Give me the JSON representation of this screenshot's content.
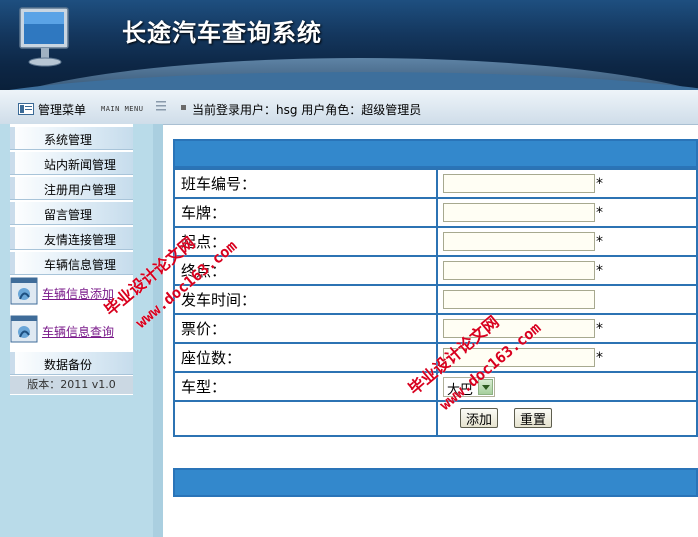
{
  "header": {
    "title": "长途汽车查询系统"
  },
  "menubar": {
    "menu_title": "管理菜单",
    "menu_subtitle": "MAIN MENU",
    "user_info": "当前登录用户：hsg  用户角色：超级管理员"
  },
  "sidebar": {
    "items": [
      {
        "label": "系统管理"
      },
      {
        "label": "站内新闻管理"
      },
      {
        "label": "注册用户管理"
      },
      {
        "label": "留言管理"
      },
      {
        "label": "友情连接管理"
      },
      {
        "label": "车辆信息管理"
      }
    ],
    "links": [
      {
        "label": "车辆信息添加"
      },
      {
        "label": "车辆信息查询"
      }
    ],
    "backup": {
      "label": "数据备份"
    },
    "version": "版本：2011  v1.0"
  },
  "form": {
    "fields": [
      {
        "label": "班车编号：",
        "value": "",
        "required": "*"
      },
      {
        "label": "车牌：",
        "value": "",
        "required": "*"
      },
      {
        "label": "起点：",
        "value": "",
        "required": "*"
      },
      {
        "label": "终点：",
        "value": "",
        "required": "*"
      },
      {
        "label": "发车时间：",
        "value": "",
        "required": ""
      },
      {
        "label": "票价：",
        "value": "",
        "required": "*"
      },
      {
        "label": "座位数：",
        "value": "",
        "required": "*"
      }
    ],
    "vehicle_type": {
      "label": "车型：",
      "selected": "大巴"
    },
    "buttons": {
      "add": "添加",
      "reset": "重置"
    }
  },
  "watermark": {
    "cn": "毕业设计论文网",
    "url": "www.doc163.com"
  },
  "colors": {
    "header_dark": "#0d2746",
    "form_blue": "#3388cc",
    "sidebar_bg": "#b9dbe9"
  }
}
